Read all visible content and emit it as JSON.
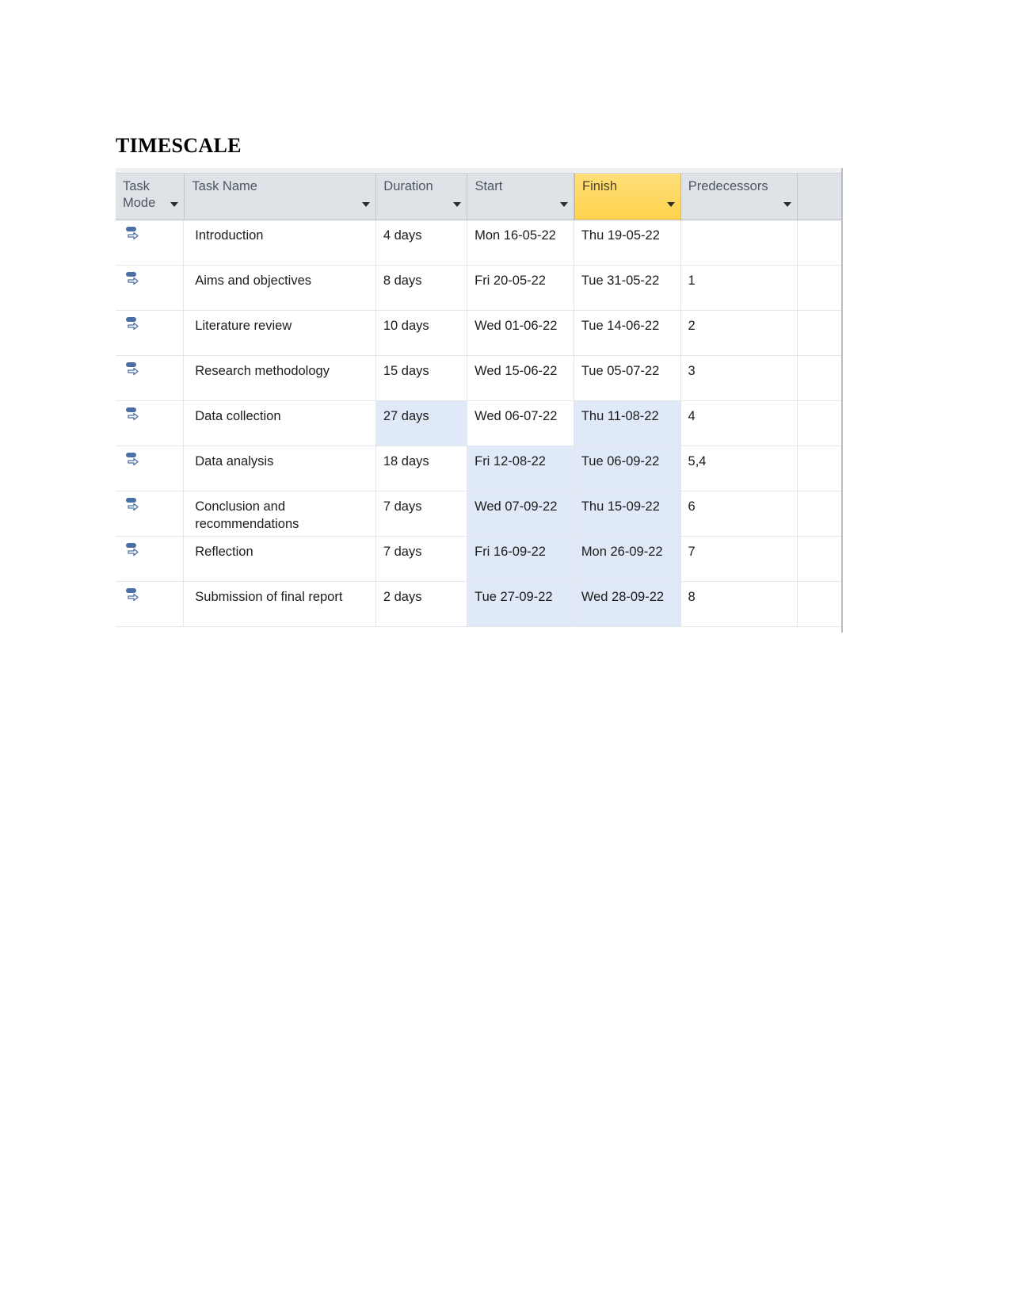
{
  "document": {
    "heading": "TIMESCALE"
  },
  "table": {
    "columns": [
      {
        "key": "task_mode",
        "label": "Task\nMode",
        "has_filter": true,
        "highlighted": false
      },
      {
        "key": "task_name",
        "label": "Task Name",
        "has_filter": true,
        "highlighted": false
      },
      {
        "key": "duration",
        "label": "Duration",
        "has_filter": true,
        "highlighted": false
      },
      {
        "key": "start",
        "label": "Start",
        "has_filter": true,
        "highlighted": false
      },
      {
        "key": "finish",
        "label": "Finish",
        "has_filter": true,
        "highlighted": true
      },
      {
        "key": "predecessors",
        "label": "Predecessors",
        "has_filter": true,
        "highlighted": false
      },
      {
        "key": "clipped",
        "label": "",
        "has_filter": false,
        "highlighted": false
      }
    ],
    "colors": {
      "header_background": "#dfe3e8",
      "header_highlight": "#ffd24d",
      "cell_selection": "#dfe9f7",
      "grid_line": "#e3e6ea",
      "task_mode_icon": "#4a6fa5"
    },
    "rows": [
      {
        "task_mode_icon": "manual-task-icon",
        "task_name": "Introduction",
        "duration": "4 days",
        "start": "Mon 16-05-22",
        "finish": "Thu 19-05-22",
        "predecessors": "",
        "selected": {
          "duration": false,
          "start": false,
          "finish": false
        }
      },
      {
        "task_mode_icon": "manual-task-icon",
        "task_name": "Aims and objectives",
        "duration": "8 days",
        "start": "Fri 20-05-22",
        "finish": "Tue 31-05-22",
        "predecessors": "1",
        "selected": {
          "duration": false,
          "start": false,
          "finish": false
        }
      },
      {
        "task_mode_icon": "manual-task-icon",
        "task_name": "Literature review",
        "duration": "10 days",
        "start": "Wed 01-06-22",
        "finish": "Tue 14-06-22",
        "predecessors": "2",
        "selected": {
          "duration": false,
          "start": false,
          "finish": false
        }
      },
      {
        "task_mode_icon": "manual-task-icon",
        "task_name": "Research methodology",
        "duration": "15 days",
        "start": "Wed 15-06-22",
        "finish": "Tue 05-07-22",
        "predecessors": "3",
        "selected": {
          "duration": false,
          "start": false,
          "finish": false
        }
      },
      {
        "task_mode_icon": "manual-task-icon",
        "task_name": "Data collection",
        "duration": "27 days",
        "start": "Wed 06-07-22",
        "finish": "Thu 11-08-22",
        "predecessors": "4",
        "selected": {
          "duration": true,
          "start": false,
          "finish": true
        }
      },
      {
        "task_mode_icon": "manual-task-icon",
        "task_name": "Data analysis",
        "duration": "18 days",
        "start": "Fri 12-08-22",
        "finish": "Tue 06-09-22",
        "predecessors": "5,4",
        "selected": {
          "duration": false,
          "start": true,
          "finish": true
        }
      },
      {
        "task_mode_icon": "manual-task-icon",
        "task_name": "Conclusion and recommendations",
        "duration": "7 days",
        "start": "Wed 07-09-22",
        "finish": "Thu 15-09-22",
        "predecessors": "6",
        "selected": {
          "duration": false,
          "start": true,
          "finish": true
        }
      },
      {
        "task_mode_icon": "manual-task-icon",
        "task_name": "Reflection",
        "duration": "7 days",
        "start": "Fri 16-09-22",
        "finish": "Mon 26-09-22",
        "predecessors": "7",
        "selected": {
          "duration": false,
          "start": true,
          "finish": true
        }
      },
      {
        "task_mode_icon": "manual-task-icon",
        "task_name": "Submission of final report",
        "duration": "2 days",
        "start": "Tue 27-09-22",
        "finish": "Wed 28-09-22",
        "predecessors": "8",
        "selected": {
          "duration": false,
          "start": true,
          "finish": true
        }
      }
    ]
  }
}
